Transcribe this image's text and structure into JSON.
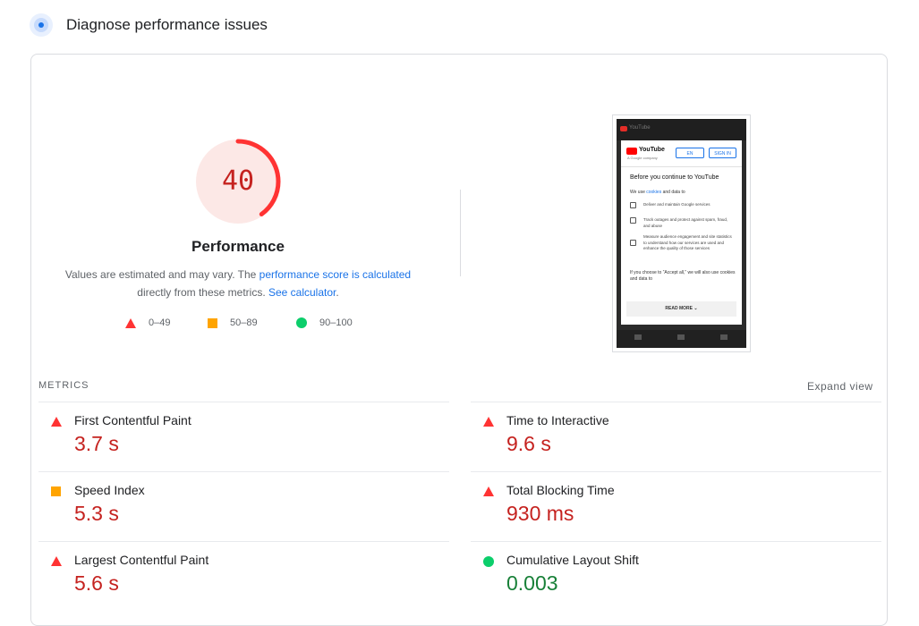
{
  "header": {
    "title": "Diagnose performance issues",
    "icon": "lighthouse-icon"
  },
  "performance": {
    "score": "40",
    "score_fraction": 0.4,
    "title": "Performance",
    "desc_before": "Values are estimated and may vary. The ",
    "desc_link1": "performance score is calculated",
    "desc_middle": "directly from these metrics. ",
    "desc_link2": "See calculator",
    "desc_end": "."
  },
  "legend": [
    {
      "range": "0–49",
      "icon": "red-triangle-icon",
      "color": "#ff3333"
    },
    {
      "range": "50–89",
      "icon": "orange-square-icon",
      "color": "#ffa400"
    },
    {
      "range": "90–100",
      "icon": "green-circle-icon",
      "color": "#0cce6b"
    }
  ],
  "screenshot": {
    "header_logo_text": "YouTube",
    "brand": "YouTube",
    "brand_sub": "A Google company",
    "lang_button": "EN",
    "signin_button": "SIGN IN",
    "dialog_title": "Before you continue to YouTube",
    "intro_before": "We use ",
    "intro_link": "cookies",
    "intro_after": " and data to",
    "items": [
      "Deliver and maintain Google services",
      "Track outages and protect against spam, fraud, and abuse",
      "Measure audience engagement and site statistics to understand how our services are used and enhance the quality of those services"
    ],
    "accept_text": "If you choose to “Accept all,” we will also use cookies and data to",
    "read_more": "READ MORE"
  },
  "metrics": {
    "title": "METRICS",
    "expand_label": "Expand view",
    "items": [
      {
        "label": "First Contentful Paint",
        "value": "3.7 s",
        "status": "poor"
      },
      {
        "label": "Time to Interactive",
        "value": "9.6 s",
        "status": "poor"
      },
      {
        "label": "Speed Index",
        "value": "5.3 s",
        "status": "average"
      },
      {
        "label": "Total Blocking Time",
        "value": "930 ms",
        "status": "poor"
      },
      {
        "label": "Largest Contentful Paint",
        "value": "5.6 s",
        "status": "poor"
      },
      {
        "label": "Cumulative Layout Shift",
        "value": "0.003",
        "status": "good"
      }
    ]
  },
  "colors": {
    "poor": "#ff3333",
    "average": "#ffa400",
    "good": "#0cce6b",
    "link": "#1a73e8"
  }
}
